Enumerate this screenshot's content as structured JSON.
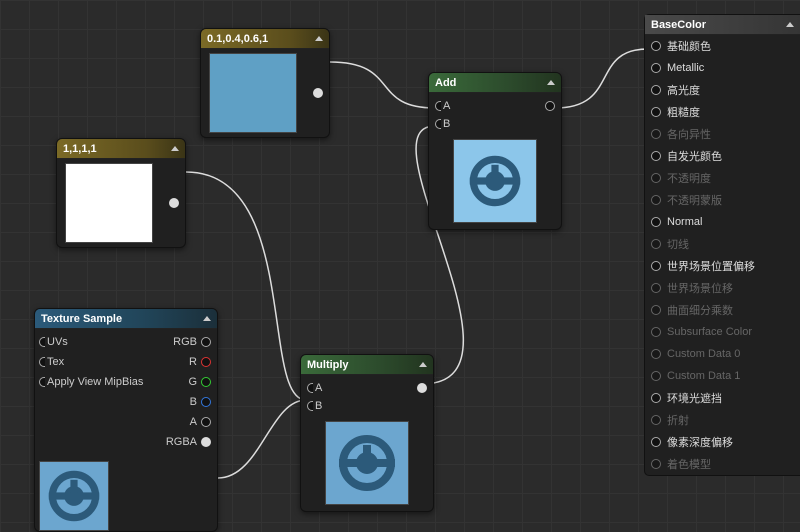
{
  "nodes": {
    "const1": {
      "title": "1,1,1,1"
    },
    "const2": {
      "title": "0.1,0.4,0.6,1"
    },
    "texsamp": {
      "title": "Texture Sample",
      "in": {
        "uvs": "UVs",
        "tex": "Tex",
        "mip": "Apply View MipBias"
      },
      "out": {
        "rgb": "RGB",
        "r": "R",
        "g": "G",
        "b": "B",
        "a": "A",
        "rgba": "RGBA"
      }
    },
    "multiply": {
      "title": "Multiply",
      "inA": "A",
      "inB": "B"
    },
    "add": {
      "title": "Add",
      "inA": "A",
      "inB": "B"
    }
  },
  "panel": {
    "title": "BaseColor",
    "rows": [
      {
        "label": "基础颜色",
        "enabled": true
      },
      {
        "label": "Metallic",
        "enabled": true
      },
      {
        "label": "高光度",
        "enabled": true
      },
      {
        "label": "粗糙度",
        "enabled": true
      },
      {
        "label": "各向异性",
        "enabled": false
      },
      {
        "label": "自发光颜色",
        "enabled": true
      },
      {
        "label": "不透明度",
        "enabled": false
      },
      {
        "label": "不透明蒙版",
        "enabled": false
      },
      {
        "label": "Normal",
        "enabled": true
      },
      {
        "label": "切线",
        "enabled": false
      },
      {
        "label": "世界场景位置偏移",
        "enabled": true
      },
      {
        "label": "世界场景位移",
        "enabled": false
      },
      {
        "label": "曲面细分乘数",
        "enabled": false
      },
      {
        "label": "Subsurface Color",
        "enabled": false
      },
      {
        "label": "Custom Data 0",
        "enabled": false
      },
      {
        "label": "Custom Data 1",
        "enabled": false
      },
      {
        "label": "环境光遮挡",
        "enabled": true
      },
      {
        "label": "折射",
        "enabled": false
      },
      {
        "label": "像素深度偏移",
        "enabled": true
      },
      {
        "label": "着色模型",
        "enabled": false
      }
    ]
  },
  "colors": {
    "accent_blue": "#5fa0c5",
    "accent_white": "#ffffff"
  }
}
